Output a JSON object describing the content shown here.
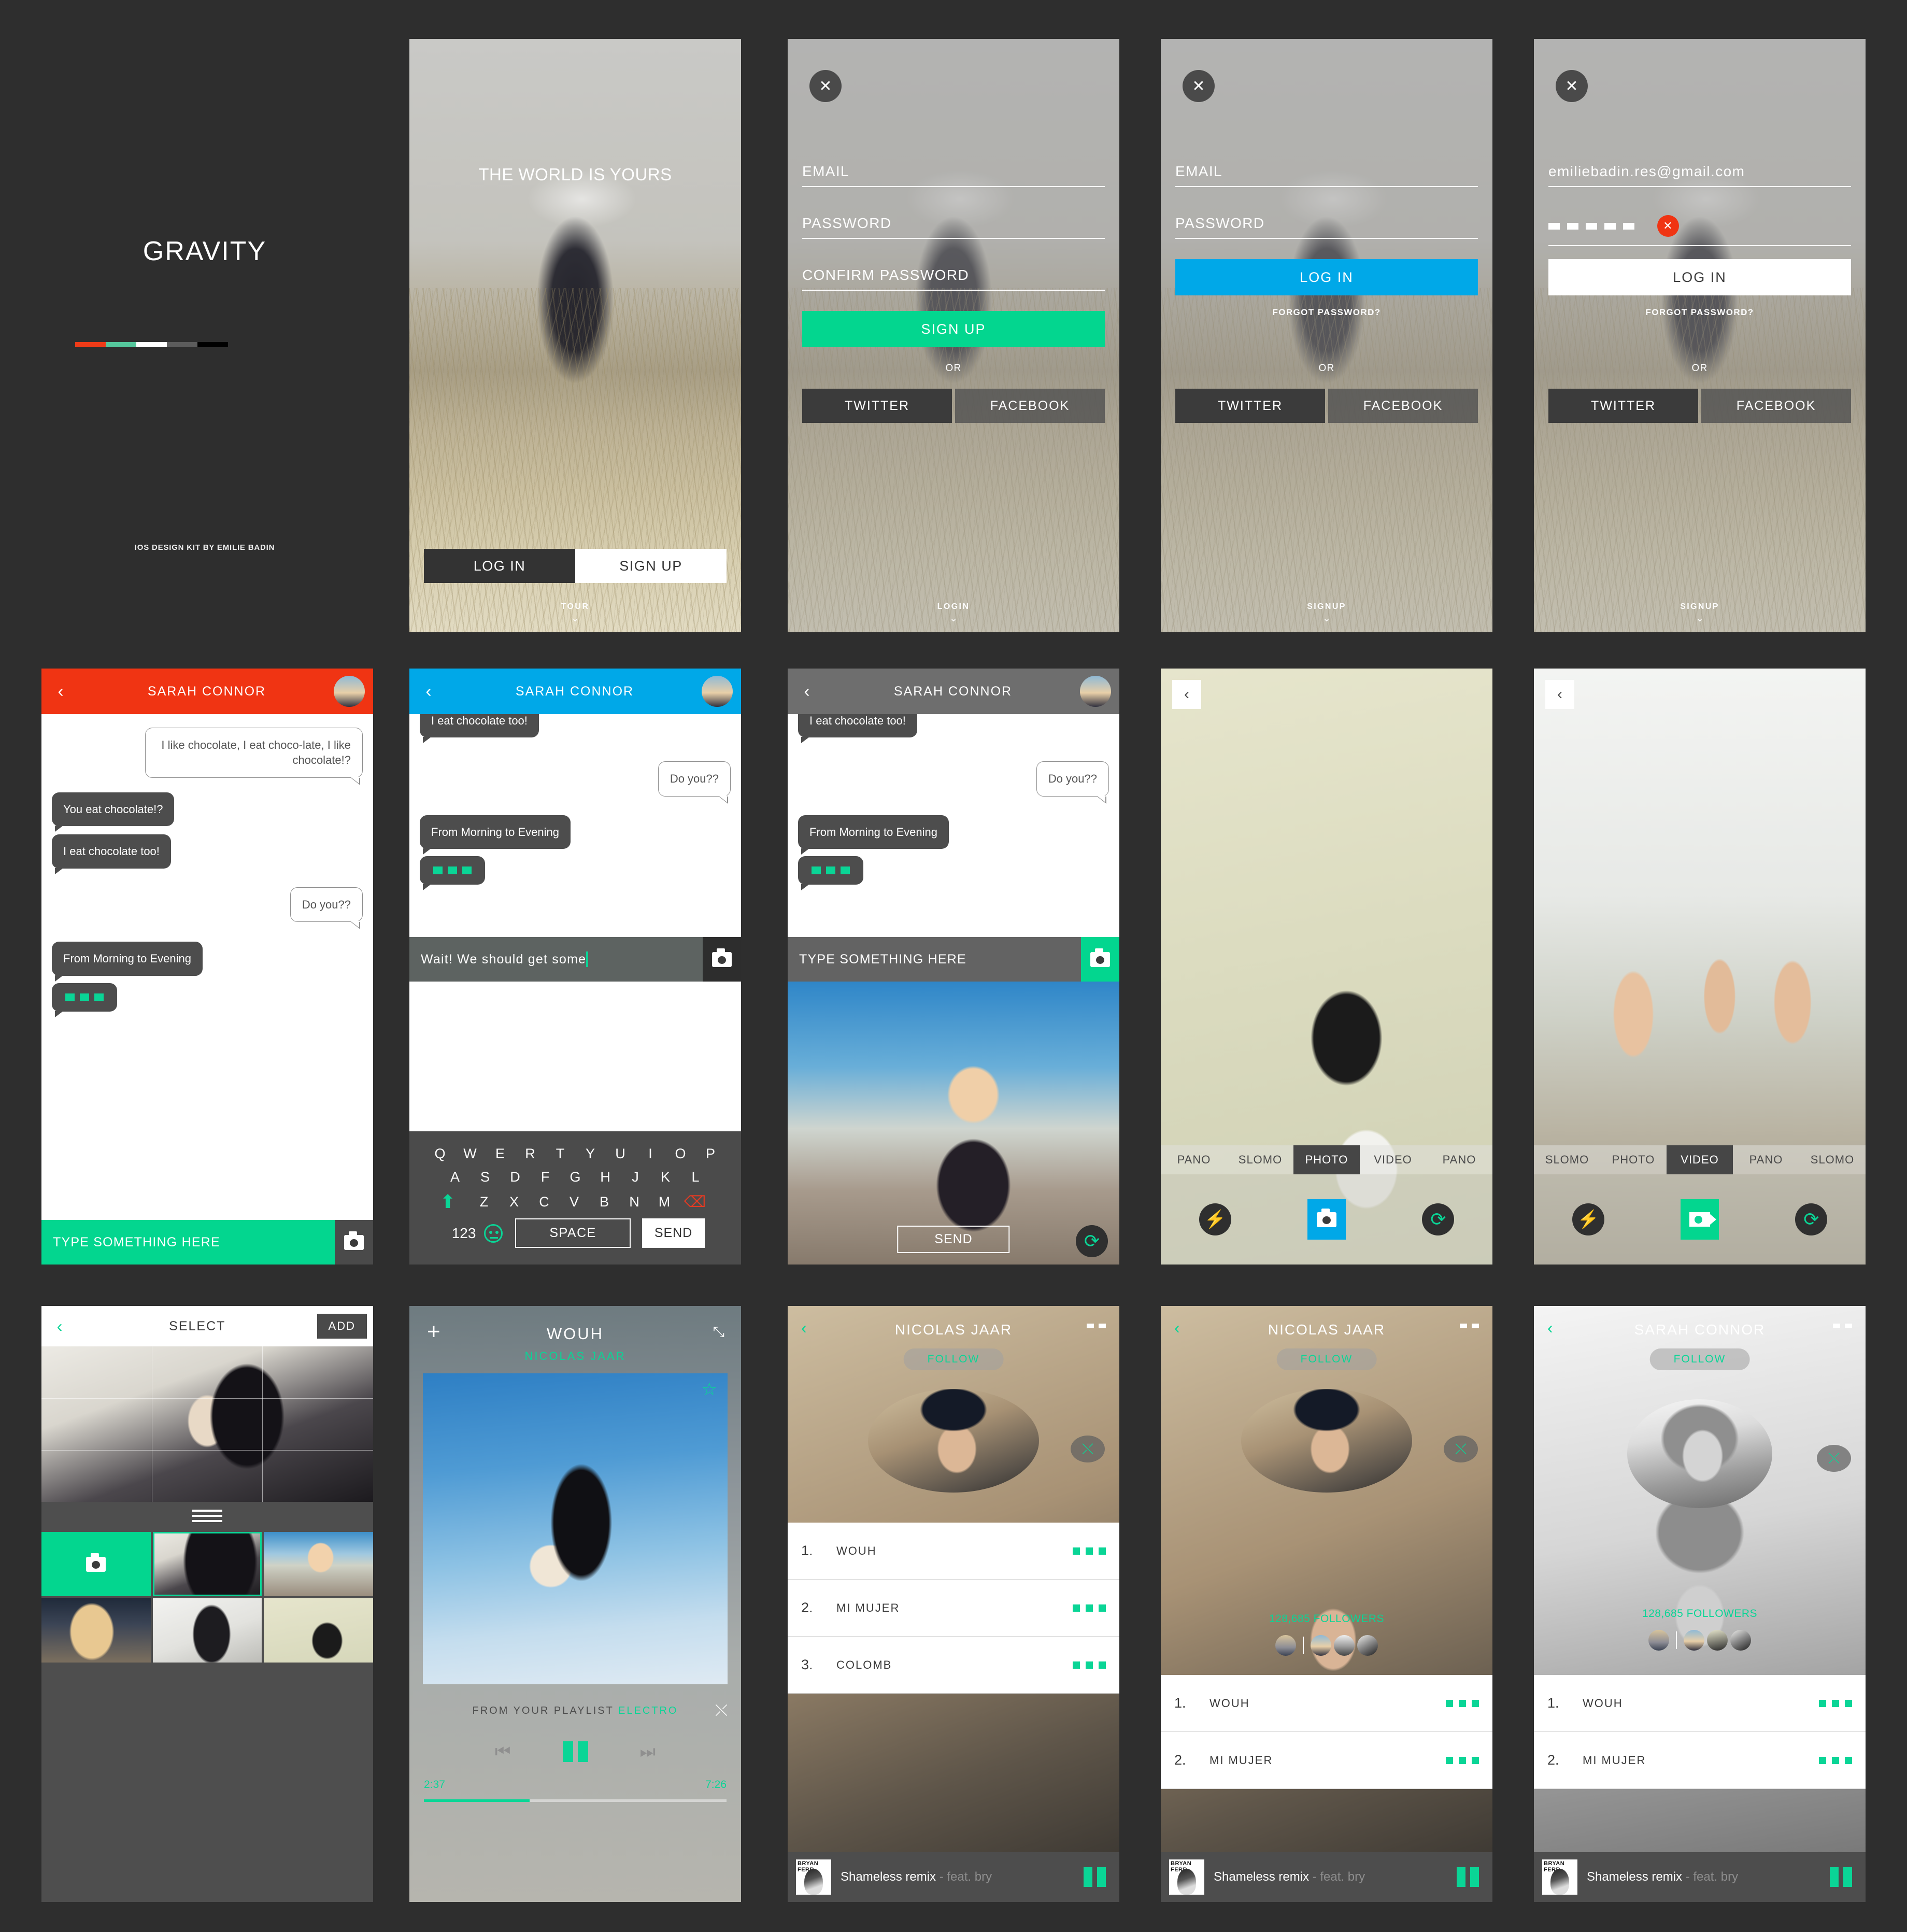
{
  "cover": {
    "title": "GRAVITY",
    "credit": "IOS DESIGN KIT BY EMILIE BADIN",
    "swatches": [
      "#ee3b18",
      "#55c79c",
      "#ffffff",
      "#5c5c5c",
      "#000000"
    ]
  },
  "tour": {
    "headline": "THE WORLD IS YOURS",
    "login_label": "LOG IN",
    "signup_label": "SIGN UP",
    "foot_label": "TOUR"
  },
  "signup": {
    "close_icon": "close-icon",
    "email_placeholder": "EMAIL",
    "password_placeholder": "PASSWORD",
    "confirm_placeholder": "CONFIRM PASSWORD",
    "primary_label": "SIGN UP",
    "or_label": "OR",
    "twitter_label": "TWITTER",
    "facebook_label": "FACEBOOK",
    "foot_label": "LOGIN"
  },
  "login_empty": {
    "close_icon": "close-icon",
    "email_placeholder": "EMAIL",
    "password_placeholder": "PASSWORD",
    "primary_label": "LOG IN",
    "forgot_label": "FORGOT PASSWORD?",
    "or_label": "OR",
    "twitter_label": "TWITTER",
    "facebook_label": "FACEBOOK",
    "foot_label": "SIGNUP",
    "primary_color": "#00a8e8"
  },
  "login_filled": {
    "close_icon": "close-icon",
    "email_value": "emiliebadin.res@gmail.com",
    "password_dots": 5,
    "error_icon": "error-close-icon",
    "primary_label": "LOG IN",
    "forgot_label": "FORGOT PASSWORD?",
    "or_label": "OR",
    "twitter_label": "TWITTER",
    "facebook_label": "FACEBOOK",
    "foot_label": "SIGNUP",
    "error_color": "#f03413"
  },
  "chat": {
    "title": "SARAH CONNOR",
    "back_icon": "chevron-left-icon",
    "avatar_name": "avatar",
    "input_placeholder": "TYPE SOMETHING HERE",
    "camera_icon": "camera-icon",
    "header_color_red": "#f03413",
    "header_color_blue": "#00a8e8",
    "header_color_gray": "#6e6e6e",
    "messages": [
      {
        "side": "me",
        "text": "I like chocolate, I eat choco-late, I like chocolate!?"
      },
      {
        "side": "them",
        "text": "You eat chocolate!?"
      },
      {
        "side": "them",
        "text": "I eat chocolate too!"
      },
      {
        "side": "me",
        "text": "Do you??"
      },
      {
        "side": "them",
        "text": "From Morning to Evening"
      },
      {
        "side": "them",
        "text": "typing"
      }
    ],
    "scroll_messages": [
      {
        "side": "them",
        "text": "I eat chocolate too!"
      },
      {
        "side": "me",
        "text": "Do you??"
      },
      {
        "side": "them",
        "text": "From Morning to Evening"
      },
      {
        "side": "them",
        "text": "typing"
      }
    ],
    "typed_value": "Wait! We should get some",
    "send_label": "SEND",
    "photo_send_label": "SEND",
    "rotate_icon": "rotate-camera-icon"
  },
  "keyboard": {
    "row1": [
      "Q",
      "W",
      "E",
      "R",
      "T",
      "Y",
      "U",
      "I",
      "O",
      "P"
    ],
    "row2": [
      "A",
      "S",
      "D",
      "F",
      "G",
      "H",
      "J",
      "K",
      "L"
    ],
    "row3": [
      "Z",
      "X",
      "C",
      "V",
      "B",
      "N",
      "M"
    ],
    "shift_icon": "shift-icon",
    "delete_icon": "backspace-icon",
    "numeric_label": "123",
    "emoji_icon": "emoji-icon",
    "space_label": "SPACE",
    "send_label": "SEND"
  },
  "camera_photo": {
    "back_icon": "chevron-left-icon",
    "modes": [
      "PANO",
      "SLOMO",
      "PHOTO",
      "VIDEO",
      "PANO"
    ],
    "active_mode": "PHOTO",
    "flash_icon": "flash-icon",
    "shutter_icon": "camera-icon",
    "rotate_icon": "rotate-camera-icon",
    "shutter_color": "#00a8e8"
  },
  "camera_video": {
    "back_icon": "chevron-left-icon",
    "modes": [
      "SLOMO",
      "PHOTO",
      "VIDEO",
      "PANO",
      "SLOMO"
    ],
    "active_mode": "VIDEO",
    "flash_icon": "flash-icon",
    "shutter_icon": "video-icon",
    "rotate_icon": "rotate-camera-icon",
    "shutter_color": "#03d68f"
  },
  "select": {
    "title": "SELECT",
    "back_icon": "chevron-left-icon",
    "add_label": "ADD",
    "handle_icon": "drag-handle-icon",
    "camera_tile_icon": "camera-icon",
    "thumbs": [
      {
        "kind": "camera",
        "selected": false
      },
      {
        "kind": "photo",
        "selected": true,
        "fill": "ph-dark-model"
      },
      {
        "kind": "photo",
        "selected": false,
        "fill": "ph-blondebeach"
      },
      {
        "kind": "photo",
        "selected": false,
        "fill": "ph-curly"
      },
      {
        "kind": "photo",
        "selected": false,
        "fill": "ph-jumper"
      },
      {
        "kind": "photo",
        "selected": false,
        "fill": "ph-catsmall"
      }
    ]
  },
  "player": {
    "add_icon": "plus-icon",
    "collapse_icon": "collapse-icon",
    "track_title": "WOUH",
    "artist": "NICOLAS JAAR",
    "favorite_icon": "star-icon",
    "playlist_prefix": "FROM YOUR PLAYLIST",
    "playlist_name": "ELECTRO",
    "shuffle_icon": "shuffle-icon",
    "prev_icon": "previous-icon",
    "pause_icon": "pause-icon",
    "next_icon": "next-icon",
    "elapsed": "2:37",
    "duration": "7:26",
    "progress_percent": 35,
    "accent": "#0ad596"
  },
  "artist_jaar": {
    "back_icon": "chevron-left-icon",
    "more_icon": "more-icon",
    "name": "NICOLAS JAAR",
    "follow_label": "FOLLOW",
    "shuffle_icon": "shuffle-icon",
    "avatar_name": "artist-avatar",
    "followers": "128,685 FOLLOWERS",
    "tracks": [
      {
        "num": "1.",
        "name": "WOUH"
      },
      {
        "num": "2.",
        "name": "MI MUJER"
      },
      {
        "num": "3.",
        "name": "COLOMB"
      }
    ],
    "tracks_short": [
      {
        "num": "1.",
        "name": "WOUH"
      },
      {
        "num": "2.",
        "name": "MI MUJER"
      }
    ]
  },
  "artist_sarah": {
    "back_icon": "chevron-left-icon",
    "more_icon": "more-icon",
    "name": "SARAH CONNOR",
    "follow_label": "FOLLOW",
    "shuffle_icon": "shuffle-icon",
    "avatar_name": "artist-avatar",
    "followers": "128,685 FOLLOWERS",
    "tracks_short": [
      {
        "num": "1.",
        "name": "WOUH"
      },
      {
        "num": "2.",
        "name": "MI MUJER"
      }
    ]
  },
  "nowplaying": {
    "cover_caption": "BRYAN FERR",
    "title": "Shameless remix",
    "subtitle": " - feat. bry",
    "pause_icon": "pause-icon"
  }
}
